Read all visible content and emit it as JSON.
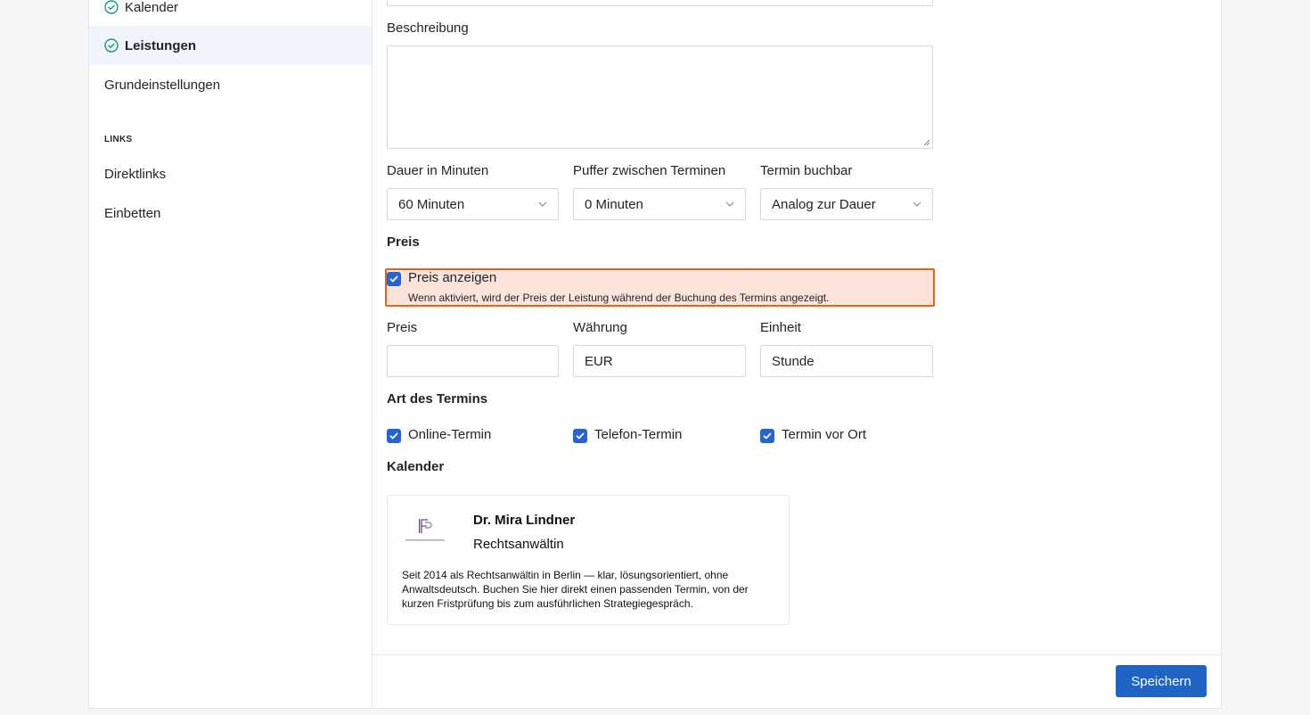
{
  "sidebar": {
    "items": [
      {
        "label": "Kalender",
        "done": true
      },
      {
        "label": "Leistungen",
        "done": true,
        "active": true
      },
      {
        "label": "Grundeinstellungen"
      }
    ],
    "links_heading": "LINKS",
    "links": [
      {
        "label": "Direktlinks"
      },
      {
        "label": "Einbetten"
      }
    ]
  },
  "form": {
    "beschreibung_label": "Beschreibung",
    "beschreibung_value": "",
    "dauer_label": "Dauer in Minuten",
    "dauer_value": "60 Minuten",
    "puffer_label": "Puffer zwischen Terminen",
    "puffer_value": "0 Minuten",
    "buchbar_label": "Termin buchbar",
    "buchbar_value": "Analog zur Dauer",
    "preis_heading": "Preis",
    "preis_anzeigen_label": "Preis anzeigen",
    "preis_anzeigen_checked": true,
    "preis_anzeigen_hint": "Wenn aktiviert, wird der Preis der Leistung während der Buchung des Termins angezeigt.",
    "preis_label": "Preis",
    "preis_value": "",
    "waehrung_label": "Währung",
    "waehrung_value": "EUR",
    "einheit_label": "Einheit",
    "einheit_value": "Stunde",
    "art_heading": "Art des Termins",
    "art_options": [
      {
        "label": "Online-Termin",
        "checked": true
      },
      {
        "label": "Telefon-Termin",
        "checked": true
      },
      {
        "label": "Termin vor Ort",
        "checked": true
      }
    ],
    "kalender_heading": "Kalender"
  },
  "calendar_card": {
    "name": "Dr. Mira Lindner",
    "role": "Rechtsanwältin",
    "description": "Seit 2014 als Rechtsanwältin in Berlin — klar, lösungsorientiert, ohne Anwaltsdeutsch. Buchen Sie hier direkt einen passenden Termin, von der kurzen Fristprüfung bis zum ausführlichen Strategiegespräch."
  },
  "footer": {
    "save_label": "Speichern"
  },
  "colors": {
    "accent": "#1f64c4",
    "checkbox": "#2563d9",
    "highlight_bg": "#fce4db",
    "highlight_border": "#e0641b",
    "done_check": "#1a9b6c"
  }
}
